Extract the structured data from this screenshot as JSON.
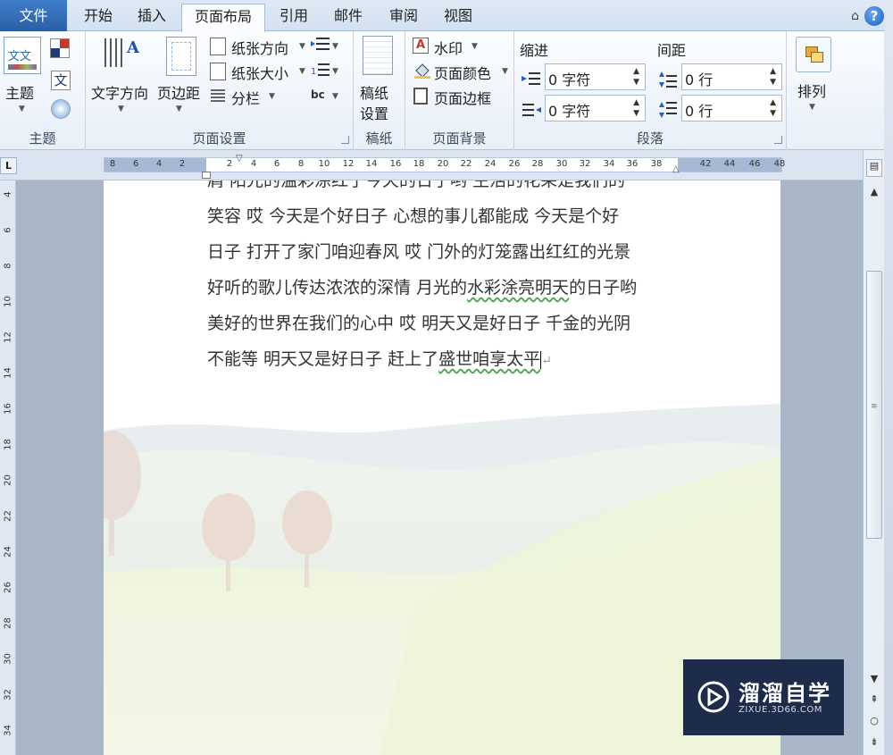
{
  "tabs": {
    "file": "文件",
    "home": "开始",
    "insert": "插入",
    "layout": "页面布局",
    "references": "引用",
    "mailings": "邮件",
    "review": "审阅",
    "view": "视图"
  },
  "help_symbol": "?",
  "ribbon": {
    "themes": {
      "theme_label": "主题",
      "group_label": "主题",
      "font_icon_text": "文",
      "theme_icon_text": "文文"
    },
    "page_setup": {
      "text_direction": "文字方向",
      "margins": "页边距",
      "orientation": "纸张方向",
      "size": "纸张大小",
      "columns": "分栏",
      "hyphen_icon_text": "bc",
      "group_label": "页面设置"
    },
    "manuscript": {
      "label_line1": "稿纸",
      "label_line2": "设置",
      "group_label": "稿纸"
    },
    "page_background": {
      "watermark": "水印",
      "page_color": "页面颜色",
      "page_borders": "页面边框",
      "group_label": "页面背景"
    },
    "paragraph": {
      "indent_title": "缩进",
      "spacing_title": "间距",
      "indent_left": "0 字符",
      "indent_right": "0 字符",
      "spacing_before": "0 行",
      "spacing_after": "0 行",
      "group_label": "段落"
    },
    "arrange": {
      "label": "排列"
    }
  },
  "ruler": {
    "horizontal_ticks": [
      "8",
      "6",
      "4",
      "2",
      "2",
      "4",
      "6",
      "8",
      "10",
      "12",
      "14",
      "16",
      "18",
      "20",
      "22",
      "24",
      "26",
      "28",
      "30",
      "32",
      "34",
      "36",
      "38",
      "42",
      "44",
      "46",
      "48"
    ],
    "vertical_ticks": [
      "4",
      "6",
      "8",
      "10",
      "12",
      "14",
      "16",
      "18",
      "20",
      "22",
      "24",
      "26",
      "28",
      "30",
      "32",
      "34"
    ],
    "tab_selector": "L"
  },
  "document": {
    "line0": "肩 阳光的温彩涂红了今天的日子哟 生活的花朵是我们的",
    "line1": "笑容  哎  今天是个好日子  心想的事儿都能成  今天是个好",
    "line2": "日子  打开了家门咱迎春风  哎  门外的灯笼露出红红的光景",
    "line3_a": "好听的歌儿传达浓浓的深情  月光的",
    "line3_b": "水彩涂亮明天",
    "line3_c": "的日子哟",
    "line4": "美好的世界在我们的心中  哎  明天又是好日子  千金的光阴",
    "line5_a": "不能等  明天又是好日子  赶上了",
    "line5_b": "盛世咱享太平",
    "paragraph_mark": "↵"
  },
  "watermark": {
    "title": "溜溜自学",
    "url": "ZIXUE.3D66.COM"
  }
}
